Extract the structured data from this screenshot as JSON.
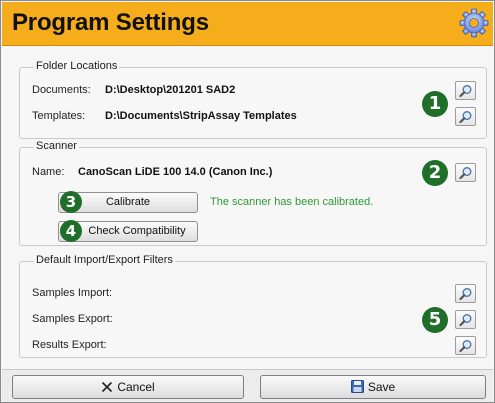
{
  "header": {
    "title": "Program Settings",
    "icon": "gear-icon"
  },
  "folders": {
    "title": "Folder Locations",
    "documents": {
      "label": "Documents:",
      "value": "D:\\Desktop\\201201 SAD2"
    },
    "templates": {
      "label": "Templates:",
      "value": "D:\\Documents\\StripAssay Templates"
    },
    "badge": "1"
  },
  "scanner": {
    "title": "Scanner",
    "name_label": "Name:",
    "name_value": "CanoScan LiDE 100 14.0 (Canon Inc.)",
    "badge": "2",
    "calibrate_badge": "3",
    "calibrate_label": "Calibrate",
    "status": "The scanner has been calibrated.",
    "compat_badge": "4",
    "compat_label": "Check Compatibility"
  },
  "filters": {
    "title": "Default Import/Export Filters",
    "samples_import": "Samples Import:",
    "samples_export": "Samples Export:",
    "results_export": "Results Export:",
    "badge": "5"
  },
  "footer": {
    "cancel_label": "Cancel",
    "save_label": "Save"
  },
  "colors": {
    "header": "#f5ad1b",
    "badge": "#1f6e2a",
    "status": "#2e9a35"
  }
}
